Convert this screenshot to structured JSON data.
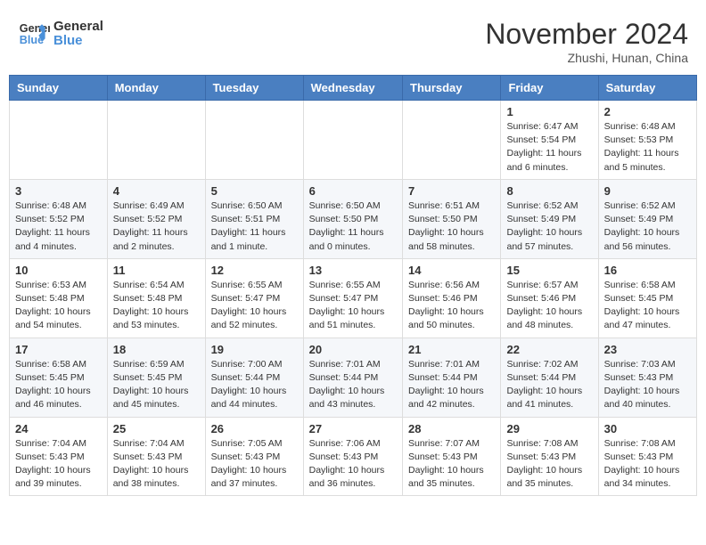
{
  "header": {
    "logo_line1": "General",
    "logo_line2": "Blue",
    "month": "November 2024",
    "location": "Zhushi, Hunan, China"
  },
  "weekdays": [
    "Sunday",
    "Monday",
    "Tuesday",
    "Wednesday",
    "Thursday",
    "Friday",
    "Saturday"
  ],
  "weeks": [
    [
      {
        "day": "",
        "info": ""
      },
      {
        "day": "",
        "info": ""
      },
      {
        "day": "",
        "info": ""
      },
      {
        "day": "",
        "info": ""
      },
      {
        "day": "",
        "info": ""
      },
      {
        "day": "1",
        "info": "Sunrise: 6:47 AM\nSunset: 5:54 PM\nDaylight: 11 hours\nand 6 minutes."
      },
      {
        "day": "2",
        "info": "Sunrise: 6:48 AM\nSunset: 5:53 PM\nDaylight: 11 hours\nand 5 minutes."
      }
    ],
    [
      {
        "day": "3",
        "info": "Sunrise: 6:48 AM\nSunset: 5:52 PM\nDaylight: 11 hours\nand 4 minutes."
      },
      {
        "day": "4",
        "info": "Sunrise: 6:49 AM\nSunset: 5:52 PM\nDaylight: 11 hours\nand 2 minutes."
      },
      {
        "day": "5",
        "info": "Sunrise: 6:50 AM\nSunset: 5:51 PM\nDaylight: 11 hours\nand 1 minute."
      },
      {
        "day": "6",
        "info": "Sunrise: 6:50 AM\nSunset: 5:50 PM\nDaylight: 11 hours\nand 0 minutes."
      },
      {
        "day": "7",
        "info": "Sunrise: 6:51 AM\nSunset: 5:50 PM\nDaylight: 10 hours\nand 58 minutes."
      },
      {
        "day": "8",
        "info": "Sunrise: 6:52 AM\nSunset: 5:49 PM\nDaylight: 10 hours\nand 57 minutes."
      },
      {
        "day": "9",
        "info": "Sunrise: 6:52 AM\nSunset: 5:49 PM\nDaylight: 10 hours\nand 56 minutes."
      }
    ],
    [
      {
        "day": "10",
        "info": "Sunrise: 6:53 AM\nSunset: 5:48 PM\nDaylight: 10 hours\nand 54 minutes."
      },
      {
        "day": "11",
        "info": "Sunrise: 6:54 AM\nSunset: 5:48 PM\nDaylight: 10 hours\nand 53 minutes."
      },
      {
        "day": "12",
        "info": "Sunrise: 6:55 AM\nSunset: 5:47 PM\nDaylight: 10 hours\nand 52 minutes."
      },
      {
        "day": "13",
        "info": "Sunrise: 6:55 AM\nSunset: 5:47 PM\nDaylight: 10 hours\nand 51 minutes."
      },
      {
        "day": "14",
        "info": "Sunrise: 6:56 AM\nSunset: 5:46 PM\nDaylight: 10 hours\nand 50 minutes."
      },
      {
        "day": "15",
        "info": "Sunrise: 6:57 AM\nSunset: 5:46 PM\nDaylight: 10 hours\nand 48 minutes."
      },
      {
        "day": "16",
        "info": "Sunrise: 6:58 AM\nSunset: 5:45 PM\nDaylight: 10 hours\nand 47 minutes."
      }
    ],
    [
      {
        "day": "17",
        "info": "Sunrise: 6:58 AM\nSunset: 5:45 PM\nDaylight: 10 hours\nand 46 minutes."
      },
      {
        "day": "18",
        "info": "Sunrise: 6:59 AM\nSunset: 5:45 PM\nDaylight: 10 hours\nand 45 minutes."
      },
      {
        "day": "19",
        "info": "Sunrise: 7:00 AM\nSunset: 5:44 PM\nDaylight: 10 hours\nand 44 minutes."
      },
      {
        "day": "20",
        "info": "Sunrise: 7:01 AM\nSunset: 5:44 PM\nDaylight: 10 hours\nand 43 minutes."
      },
      {
        "day": "21",
        "info": "Sunrise: 7:01 AM\nSunset: 5:44 PM\nDaylight: 10 hours\nand 42 minutes."
      },
      {
        "day": "22",
        "info": "Sunrise: 7:02 AM\nSunset: 5:44 PM\nDaylight: 10 hours\nand 41 minutes."
      },
      {
        "day": "23",
        "info": "Sunrise: 7:03 AM\nSunset: 5:43 PM\nDaylight: 10 hours\nand 40 minutes."
      }
    ],
    [
      {
        "day": "24",
        "info": "Sunrise: 7:04 AM\nSunset: 5:43 PM\nDaylight: 10 hours\nand 39 minutes."
      },
      {
        "day": "25",
        "info": "Sunrise: 7:04 AM\nSunset: 5:43 PM\nDaylight: 10 hours\nand 38 minutes."
      },
      {
        "day": "26",
        "info": "Sunrise: 7:05 AM\nSunset: 5:43 PM\nDaylight: 10 hours\nand 37 minutes."
      },
      {
        "day": "27",
        "info": "Sunrise: 7:06 AM\nSunset: 5:43 PM\nDaylight: 10 hours\nand 36 minutes."
      },
      {
        "day": "28",
        "info": "Sunrise: 7:07 AM\nSunset: 5:43 PM\nDaylight: 10 hours\nand 35 minutes."
      },
      {
        "day": "29",
        "info": "Sunrise: 7:08 AM\nSunset: 5:43 PM\nDaylight: 10 hours\nand 35 minutes."
      },
      {
        "day": "30",
        "info": "Sunrise: 7:08 AM\nSunset: 5:43 PM\nDaylight: 10 hours\nand 34 minutes."
      }
    ]
  ]
}
